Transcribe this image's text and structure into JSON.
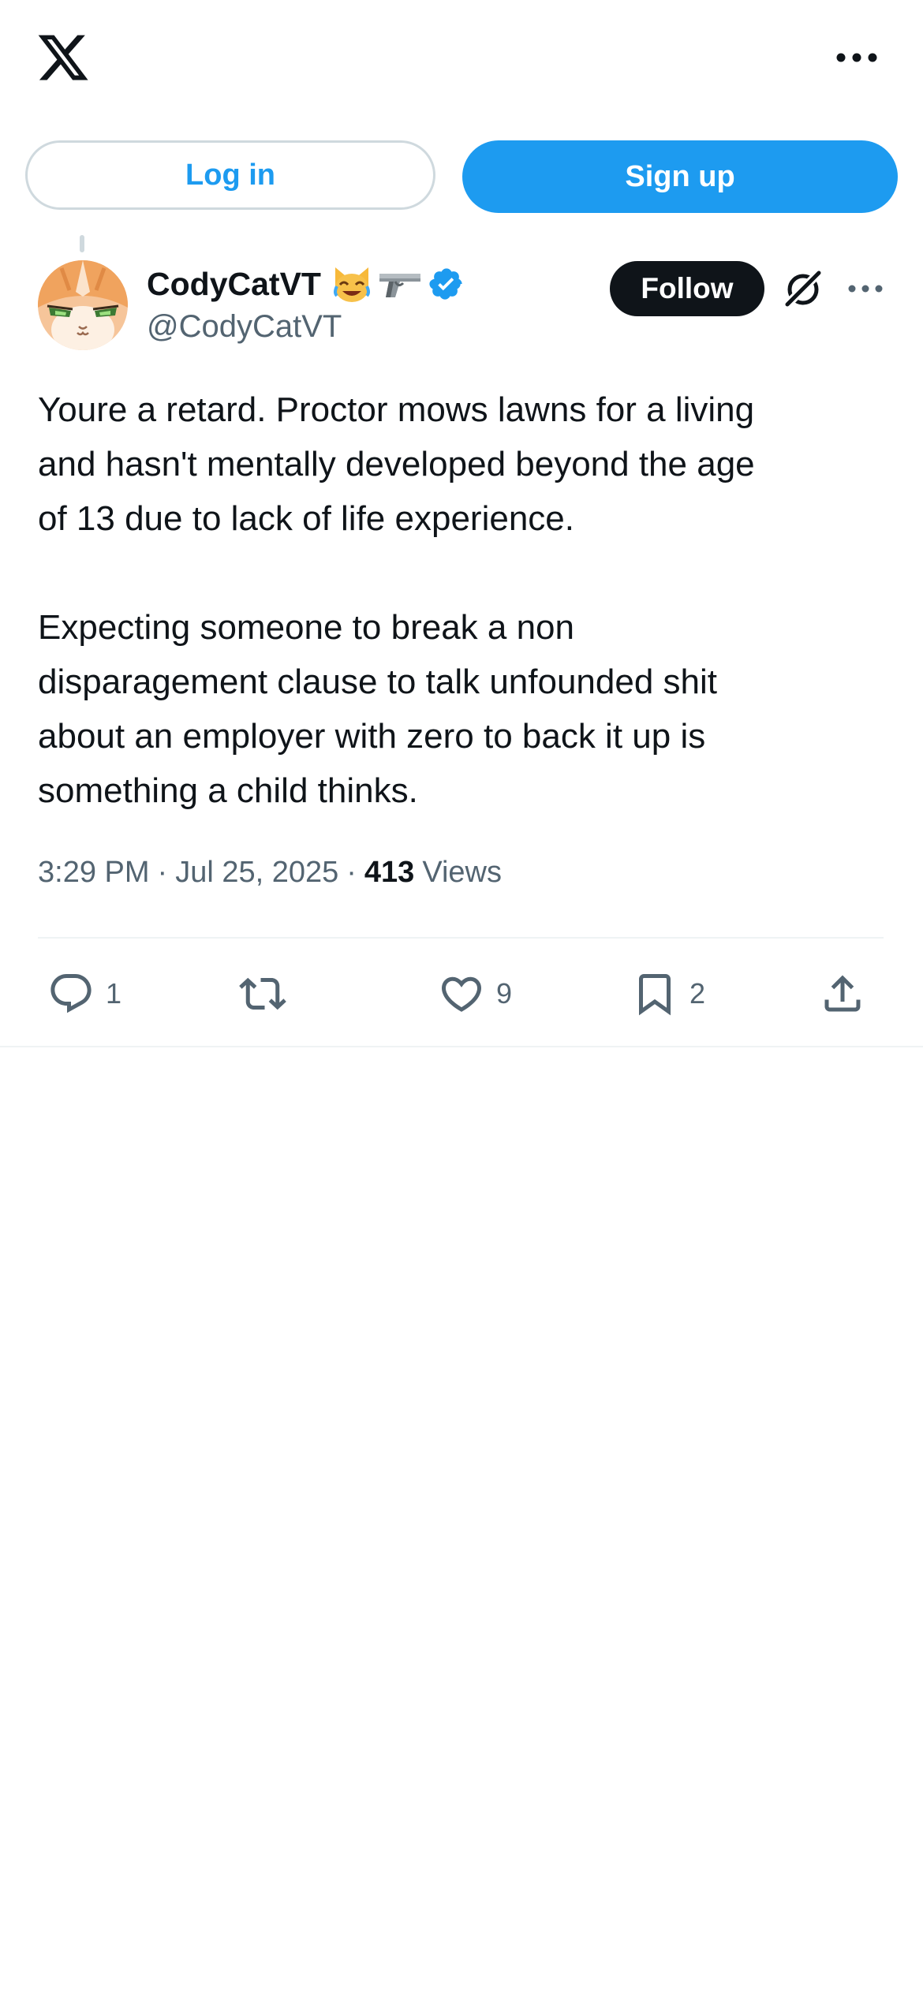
{
  "header": {
    "logo": "x-logo-icon",
    "more_icon": "more-horizontal-icon"
  },
  "auth": {
    "login_label": "Log in",
    "signup_label": "Sign up"
  },
  "tweet": {
    "display_name": "CodyCatVT",
    "name_emojis": [
      "cat-with-tears-of-joy-emoji",
      "pistol-emoji"
    ],
    "verified": "verified-badge-icon",
    "handle": "@CodyCatVT",
    "follow_label": "Follow",
    "text": "Youre a retard. Proctor mows lawns for a living\nand hasn't mentally developed beyond the age\nof 13 due to lack of life experience.\n\nExpecting someone to break a non\ndisparagement clause to talk unfounded shit\nabout an employer with zero to back it up is\nsomething a child thinks.",
    "time": "3:29 PM",
    "date": "Jul 25, 2025",
    "separator": "·",
    "views_count": "413",
    "views_label": "Views",
    "actions": {
      "reply_count": "1",
      "retweet_count": "",
      "like_count": "9",
      "bookmark_count": "2"
    }
  },
  "colors": {
    "accent": "#1d9bf0",
    "text_primary": "#0f1419",
    "text_secondary": "#536471",
    "border": "#cfd9de",
    "divider": "#eff3f4"
  }
}
